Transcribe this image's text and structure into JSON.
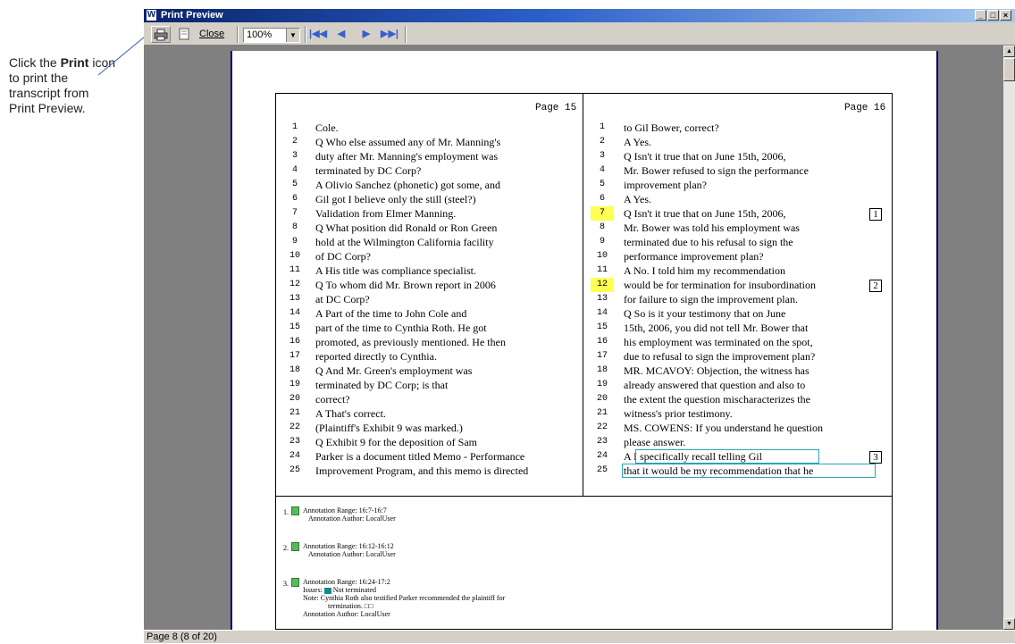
{
  "callout": {
    "pre": "Click the ",
    "bold": "Print",
    "post": " icon to print the transcript from Print Preview."
  },
  "window": {
    "title": "Print Preview",
    "app_icon": "W",
    "controls": {
      "minimize": "_",
      "maximize": "□",
      "close": "×"
    }
  },
  "toolbar": {
    "print_icon": "printer-icon",
    "page_setup_icon": "page-icon",
    "close_label": "Close",
    "zoom_value": "100%",
    "nav": {
      "first": "|◀◀",
      "prev": "◀",
      "next": "▶",
      "last": "▶▶|"
    }
  },
  "status": {
    "text": "Page 8 (8 of 20)"
  },
  "transcript": {
    "left_header": "Page 15",
    "right_header": "Page 16",
    "left_lines": [
      {
        "n": "1",
        "t": "Cole."
      },
      {
        "n": "2",
        "t": "   Q  Who else assumed any of Mr. Manning's"
      },
      {
        "n": "3",
        "t": "duty after Mr. Manning's employment was"
      },
      {
        "n": "4",
        "t": "terminated by DC Corp?"
      },
      {
        "n": "5",
        "t": "   A  Olivio Sanchez (phonetic) got some, and"
      },
      {
        "n": "6",
        "t": "Gil got I believe only the still (steel?)"
      },
      {
        "n": "7",
        "t": "Validation from Elmer Manning."
      },
      {
        "n": "8",
        "t": "   Q  What position did Ronald or Ron Green"
      },
      {
        "n": "9",
        "t": "hold at the Wilmington California facility"
      },
      {
        "n": "10",
        "t": "of DC Corp?"
      },
      {
        "n": "11",
        "t": "   A  His title was compliance specialist."
      },
      {
        "n": "12",
        "t": "   Q  To whom did Mr. Brown report in 2006"
      },
      {
        "n": "13",
        "t": "at DC Corp?"
      },
      {
        "n": "14",
        "t": "   A  Part of the time to John Cole and"
      },
      {
        "n": "15",
        "t": "part of the time to Cynthia Roth.  He got"
      },
      {
        "n": "16",
        "t": "promoted, as previously mentioned.  He then"
      },
      {
        "n": "17",
        "t": "reported directly to Cynthia."
      },
      {
        "n": "18",
        "t": "   Q  And Mr. Green's employment was"
      },
      {
        "n": "19",
        "t": "terminated by DC Corp; is that"
      },
      {
        "n": "20",
        "t": "correct?"
      },
      {
        "n": "21",
        "t": "   A  That's correct."
      },
      {
        "n": "22",
        "t": "     (Plaintiff's Exhibit 9 was marked.)"
      },
      {
        "n": "23",
        "t": "   Q  Exhibit 9 for the deposition of Sam"
      },
      {
        "n": "24",
        "t": "Parker is a document titled Memo - Performance"
      },
      {
        "n": "25",
        "t": "Improvement Program, and this memo is directed"
      }
    ],
    "right_lines": [
      {
        "n": "1",
        "t": "to Gil Bower, correct?"
      },
      {
        "n": "2",
        "t": "   A  Yes."
      },
      {
        "n": "3",
        "t": "   Q  Isn't it true that on June 15th, 2006,"
      },
      {
        "n": "4",
        "t": "Mr. Bower refused to sign the performance"
      },
      {
        "n": "5",
        "t": "improvement plan?"
      },
      {
        "n": "6",
        "t": "   A  Yes."
      },
      {
        "n": "7",
        "t": "   Q  Isn't it true that on June 15th, 2006,"
      },
      {
        "n": "8",
        "t": "Mr. Bower was told his employment was"
      },
      {
        "n": "9",
        "t": "terminated due to his refusal to sign the"
      },
      {
        "n": "10",
        "t": "performance improvement plan?"
      },
      {
        "n": "11",
        "t": "   A  No.  I told him my recommendation"
      },
      {
        "n": "12",
        "t": "would be for termination for insubordination"
      },
      {
        "n": "13",
        "t": "for failure to sign the improvement plan."
      },
      {
        "n": "14",
        "t": "   Q  So is it your testimony that on June"
      },
      {
        "n": "15",
        "t": "15th, 2006, you did not tell Mr. Bower that"
      },
      {
        "n": "16",
        "t": "his employment was terminated on the spot,"
      },
      {
        "n": "17",
        "t": "due to refusal to sign the improvement plan?"
      },
      {
        "n": "18",
        "t": "   MR. MCAVOY:  Objection, the witness has"
      },
      {
        "n": "19",
        "t": "already answered that question and also to"
      },
      {
        "n": "20",
        "t": "the extent the question mischaracterizes the"
      },
      {
        "n": "21",
        "t": "witness's prior testimony."
      },
      {
        "n": "22",
        "t": "   MS. COWENS:  If you understand he question"
      },
      {
        "n": "23",
        "t": "please answer."
      },
      {
        "n": "24",
        "t": "   A  I specifically recall telling Gil"
      },
      {
        "n": "25",
        "t": "that it would be my recommendation that he"
      }
    ],
    "markers": [
      "1",
      "2",
      "3"
    ]
  },
  "annotations": [
    {
      "num": "1.",
      "range": "Annotation Range: 16:7-16:7",
      "author": "Annotation Author: LocalUser"
    },
    {
      "num": "2.",
      "range": "Annotation Range: 16:12-16:12",
      "author": "Annotation Author: LocalUser"
    },
    {
      "num": "3.",
      "range": "Annotation Range: 16:24-17:2",
      "issues_label": "Issues:",
      "issue": "Not terminated",
      "note": "Note: Cynthia Roth also testified Parker recommended the plaintiff for",
      "note2": "termination. □□",
      "author": "Annotation Author: LocalUser",
      "issue_color": "#138b8b"
    }
  ]
}
